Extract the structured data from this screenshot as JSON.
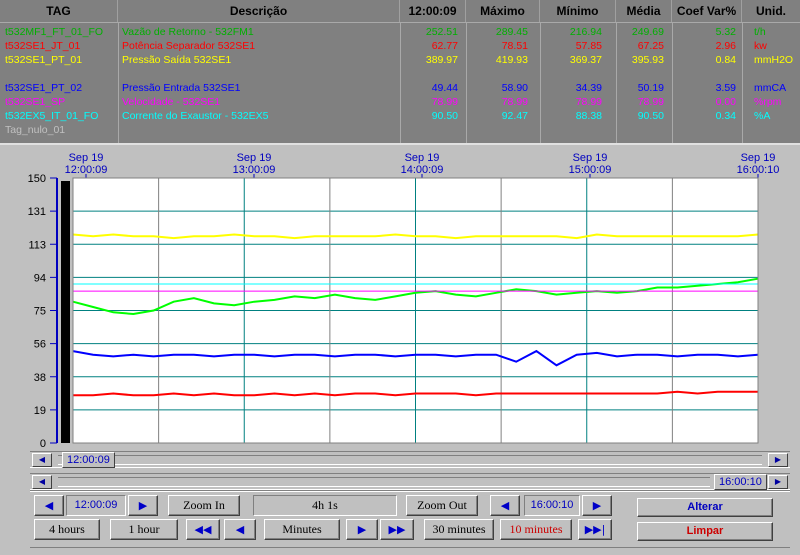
{
  "table": {
    "headers": {
      "tag": "TAG",
      "descricao": "Descrição",
      "time": "12:00:09",
      "maximo": "Máximo",
      "minimo": "Mínimo",
      "media": "Média",
      "coef": "Coef Var%",
      "unid": "Unid."
    },
    "rows": [
      {
        "tag": "t532MF1_FT_01_FO",
        "desc": "Vazão de Retorno - 532FM1",
        "value": "252.51",
        "max": "289.45",
        "min": "216.94",
        "avg": "249.69",
        "coef": "5.32",
        "unit": "t/h",
        "color": "#00b000"
      },
      {
        "tag": "t532SE1_JT_01",
        "desc": "Potência Separador 532SE1",
        "value": "62.77",
        "max": "78.51",
        "min": "57.85",
        "avg": "67.25",
        "coef": "2.96",
        "unit": "kw",
        "color": "#ff0000"
      },
      {
        "tag": "t532SE1_PT_01",
        "desc": "Pressão Saída 532SE1",
        "value": "389.97",
        "max": "419.93",
        "min": "369.37",
        "avg": "395.93",
        "coef": "0.84",
        "unit": "mmH2O",
        "color": "#ffff00"
      },
      {
        "tag": "",
        "desc": "",
        "value": "",
        "max": "",
        "min": "",
        "avg": "",
        "coef": "",
        "unit": "",
        "color": "#000000"
      },
      {
        "tag": "t532SE1_PT_02",
        "desc": "Pressão Entrada 532SE1",
        "value": "49.44",
        "max": "58.90",
        "min": "34.39",
        "avg": "50.19",
        "coef": "3.59",
        "unit": "mmCA",
        "color": "#0000ff"
      },
      {
        "tag": "t532SE1_SP",
        "desc": "Velocidade - 532SE1",
        "value": "78.99",
        "max": "78.99",
        "min": "78.99",
        "avg": "78.99",
        "coef": "0.00",
        "unit": "%rpm",
        "color": "#ff00ff"
      },
      {
        "tag": "t532EX5_IT_01_FO",
        "desc": "Corrente do Exaustor - 532EX5",
        "value": "90.50",
        "max": "92.47",
        "min": "88.38",
        "avg": "90.50",
        "coef": "0.34",
        "unit": "%A",
        "color": "#00ffff"
      },
      {
        "tag": "Tag_nulo_01",
        "desc": "",
        "value": "",
        "max": "",
        "min": "",
        "avg": "",
        "coef": "",
        "unit": "",
        "color": "#c0c0c0"
      }
    ]
  },
  "chart_data": {
    "type": "line",
    "y_ticks": [
      "150",
      "131",
      "113",
      "94",
      "75",
      "56",
      "38",
      "19",
      "0"
    ],
    "ylim": [
      0,
      150
    ],
    "x_ticks": [
      {
        "date": "Sep 19",
        "time": "12:00:09"
      },
      {
        "date": "Sep 19",
        "time": "13:00:09"
      },
      {
        "date": "Sep 19",
        "time": "14:00:09"
      },
      {
        "date": "Sep 19",
        "time": "15:00:09"
      },
      {
        "date": "Sep 19",
        "time": "16:00:10"
      }
    ],
    "grid": true,
    "series": [
      {
        "color": "#ffff00",
        "values": [
          118,
          117,
          118,
          117,
          117,
          116,
          117,
          117,
          118,
          117,
          117,
          116,
          117,
          117,
          117,
          117,
          118,
          117,
          117,
          116,
          117,
          117,
          117,
          117,
          117,
          116,
          118,
          117,
          117,
          117,
          117,
          117,
          117,
          117,
          118
        ]
      },
      {
        "color": "#00ff00",
        "values": [
          80,
          77,
          74,
          73,
          75,
          80,
          82,
          79,
          78,
          80,
          81,
          83,
          82,
          84,
          82,
          81,
          83,
          85,
          86,
          84,
          83,
          85,
          87,
          86,
          84,
          85,
          86,
          85,
          86,
          88,
          88,
          89,
          90,
          91,
          93
        ]
      },
      {
        "color": "#00ffff",
        "values": [
          90,
          90,
          90,
          90,
          90,
          90,
          90,
          90,
          90,
          90,
          90,
          90,
          90,
          90,
          90,
          90,
          90,
          90,
          90,
          90,
          90,
          90,
          90,
          90,
          90,
          90,
          90,
          90,
          90,
          90,
          90,
          90,
          90,
          90,
          90
        ]
      },
      {
        "color": "#ff00ff",
        "values": [
          86,
          86,
          86,
          86,
          86,
          86,
          86,
          86,
          86,
          86,
          86,
          86,
          86,
          86,
          86,
          86,
          86,
          86,
          86,
          86,
          86,
          86,
          86,
          86,
          86,
          86,
          86,
          86,
          86,
          86,
          86,
          86,
          86,
          86,
          86
        ]
      },
      {
        "color": "#0000ff",
        "values": [
          52,
          50,
          49,
          50,
          49,
          50,
          50,
          49,
          50,
          50,
          49,
          50,
          50,
          49,
          50,
          50,
          49,
          50,
          50,
          49,
          50,
          50,
          46,
          52,
          44,
          50,
          51,
          49,
          50,
          50,
          49,
          50,
          50,
          49,
          50
        ]
      },
      {
        "color": "#ff0000",
        "values": [
          27,
          27,
          28,
          27,
          27,
          28,
          27,
          28,
          27,
          27,
          28,
          27,
          28,
          27,
          28,
          28,
          27,
          28,
          28,
          28,
          27,
          28,
          28,
          28,
          28,
          28,
          28,
          28,
          28,
          28,
          29,
          28,
          29,
          29,
          29
        ]
      }
    ]
  },
  "scroll": {
    "start_time": "12:00:09",
    "end_time": "16:00:10"
  },
  "controls": {
    "start_time": "12:00:09",
    "zoom_in": "Zoom In",
    "span": "4h 1s",
    "zoom_out": "Zoom Out",
    "end_time": "16:00:10",
    "alterar": "Alterar",
    "limpar": "Limpar",
    "btn_4hours": "4 hours",
    "btn_1hour": "1 hour",
    "btn_minutes": "Minutes",
    "btn_30min": "30 minutes",
    "btn_10min": "10 minutes"
  }
}
